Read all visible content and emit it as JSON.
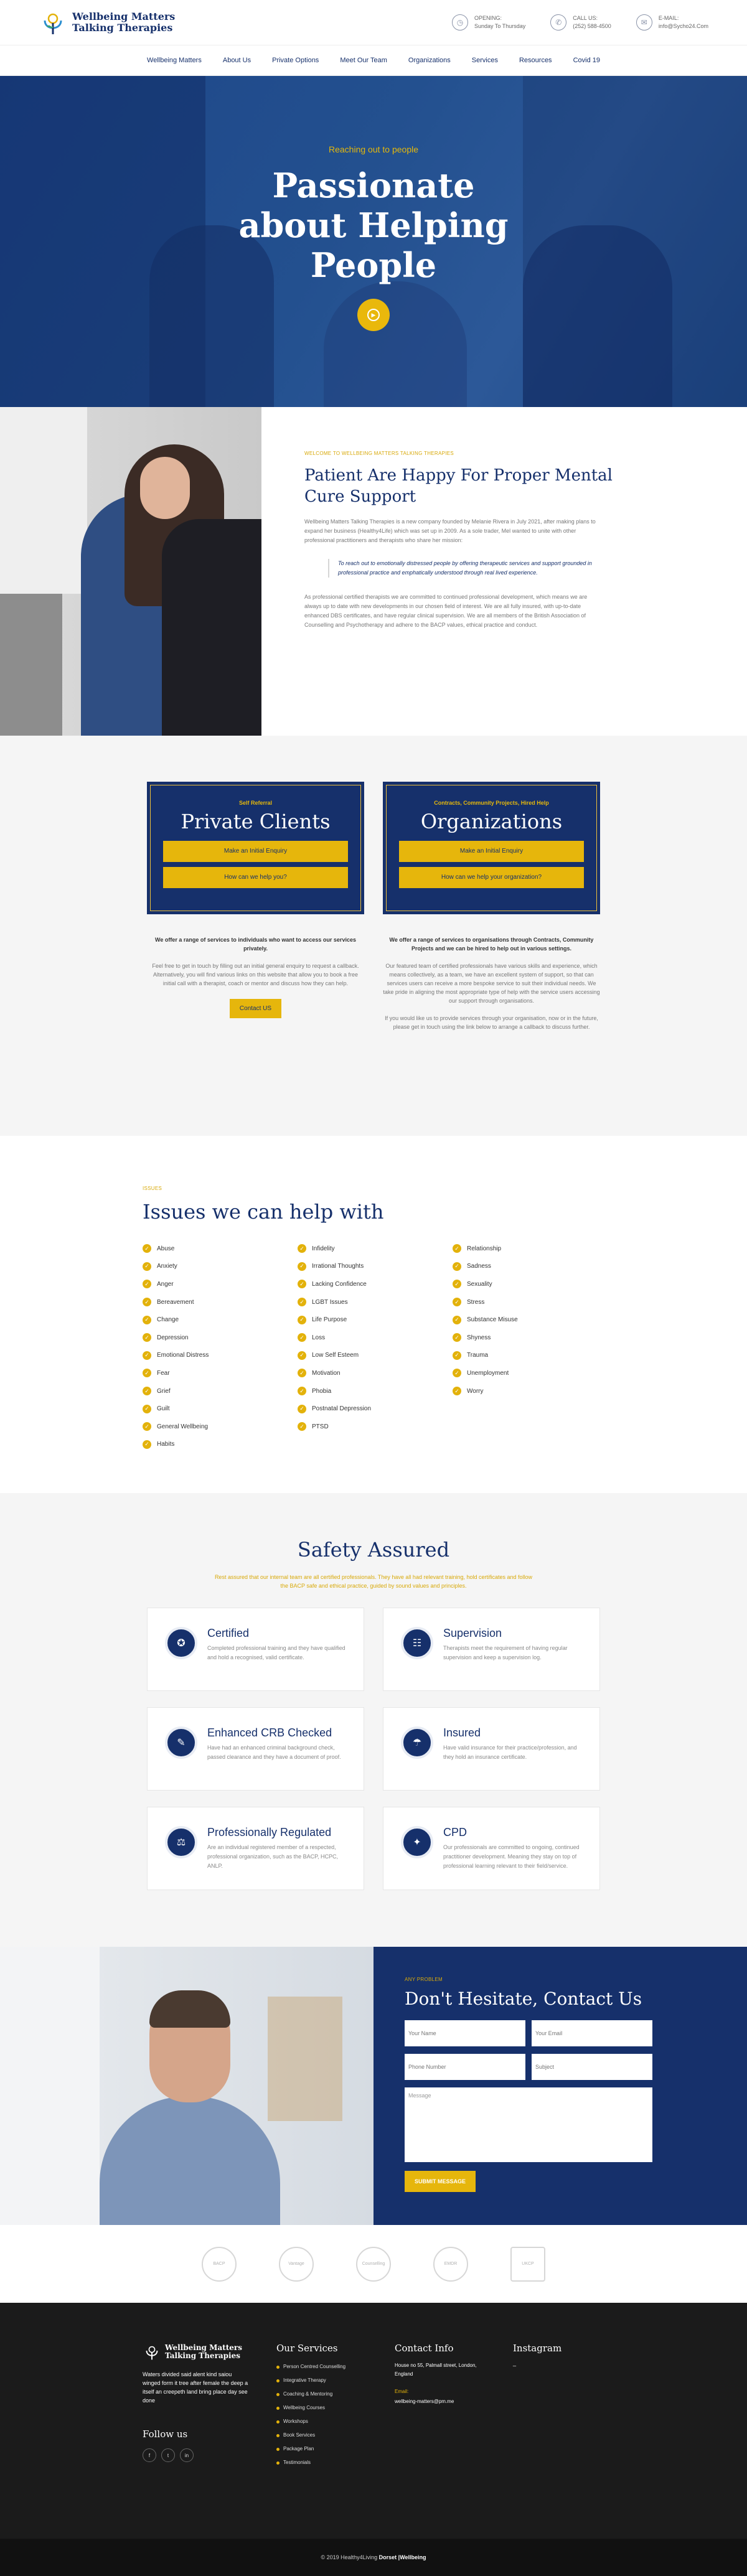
{
  "brand": {
    "line1": "Wellbeing Matters",
    "line2": "Talking Therapies"
  },
  "header": {
    "contacts": [
      {
        "icon": "clock-icon",
        "label": "OPENING:",
        "value": "Sunday To Thursday"
      },
      {
        "icon": "phone-icon",
        "label": "CALL US:",
        "value": "(252) 588-4500"
      },
      {
        "icon": "mail-icon",
        "label": "E-MAIL:",
        "value": "info@Sycho24.Com"
      }
    ]
  },
  "nav": [
    "Wellbeing Matters",
    "About Us",
    "Private Options",
    "Meet Our Team",
    "Organizations",
    "Services",
    "Resources",
    "Covid 19"
  ],
  "hero": {
    "kicker": "Reaching out to people",
    "title_l1": "Passionate",
    "title_l2": "about Helping",
    "title_l3": "People"
  },
  "about": {
    "kicker": "WELCOME TO WELLBEING MATTERS TALKING THERAPIES",
    "title": "Patient Are Happy For Proper Mental Cure Support",
    "p1": "Wellbeing Matters Talking Therapies is a new company founded by Melanie Rivera in July 2021, after making plans to expand her business (Healthy4Life) which was set up in 2009. As a sole trader, Mel wanted to unite with other professional practitioners and therapists who share her mission:",
    "quote": "To reach out to emotionally distressed people by offering therapeutic services and support grounded in professional practice and emphatically understood through real lived experience.",
    "p2": "As professional certified therapists we are committed to continued professional development, which means we are always up to date with new developments in our chosen field of interest. We are all fully insured, with up-to-date enhanced DBS certificates, and have regular clinical supervision. We are all members of the British Association of Counselling and Psychotherapy and adhere to the BACP values, ethical practice and conduct."
  },
  "cards": [
    {
      "kicker": "Self Referral",
      "title": "Private Clients",
      "btn1": "Make an Initial Enquiry",
      "btn2": "How can we help you?",
      "lead": "We offer a range of services to individuals who want to access our services privately.",
      "body": "Feel free to get in touch by filling out an initial general enquiry to request a callback. Alternatively, you will find various links on this website that allow you to book a free initial call with a therapist, coach or mentor and discuss how they can help.",
      "extra": "",
      "button": "Contact US"
    },
    {
      "kicker": "Contracts, Community Projects, Hired Help",
      "title": "Organizations",
      "btn1": "Make an Initial Enquiry",
      "btn2": "How can we help your organization?",
      "lead": "We offer a range of services to organisations through Contracts, Community Projects and we can be hired to help out in various settings.",
      "body": "Our featured team of certified professionals have various skills and experience, which means collectively, as a team, we have an excellent system of support, so that can services users can receive a more bespoke service to suit their individual needs. We take pride in aligning the most appropriate type of help with the service users accessing our support through organisations.",
      "extra": "If you would like us to provide services through your organisation, now or in the future, please get in touch using the link below to arrange a callback to discuss further.",
      "button": ""
    }
  ],
  "issues": {
    "kicker": "ISSUES",
    "title": "Issues we can help with",
    "col1": [
      "Abuse",
      "Anxiety",
      "Anger",
      "Bereavement",
      "Change",
      "Depression",
      "Emotional Distress",
      "Fear",
      "Grief",
      "Guilt",
      "General Wellbeing",
      "Habits"
    ],
    "col2": [
      "Infidelity",
      "Irrational Thoughts",
      "Lacking Confidence",
      "LGBT Issues",
      "Life Purpose",
      "Loss",
      "Low Self Esteem",
      "Motivation",
      "Phobia",
      "Postnatal Depression",
      "PTSD"
    ],
    "col3": [
      "Relationship",
      "Sadness",
      "Sexuality",
      "Stress",
      "Substance Misuse",
      "Shyness",
      "Trauma",
      "Unemployment",
      "Worry"
    ]
  },
  "safety": {
    "title": "Safety Assured",
    "sub": "Rest assured that our internal team are all certified professionals. They have all had relevant training, hold certificates and follow the BACP safe and ethical practice, guided by sound values and principles.",
    "items": [
      {
        "icon": "certificate-icon",
        "glyph": "✪",
        "title": "Certified",
        "text": "Completed professional training and they have qualified and hold a recognised, valid certificate."
      },
      {
        "icon": "supervision-icon",
        "glyph": "☷",
        "title": "Supervision",
        "text": "Therapists meet the requirement of having regular supervision and keep a supervision log."
      },
      {
        "icon": "crb-check-icon",
        "glyph": "✎",
        "title": "Enhanced CRB Checked",
        "text": "Have had an enhanced criminal background check, passed clearance and they have a document of proof."
      },
      {
        "icon": "insured-icon",
        "glyph": "☂",
        "title": "Insured",
        "text": "Have valid insurance for their practice/profession, and they hold an insurance certificate."
      },
      {
        "icon": "regulated-icon",
        "glyph": "⚖",
        "title": "Professionally Regulated",
        "text": "Are an individual registered member of a respected, professional organization, such as the BACP, HCPC, ANLP."
      },
      {
        "icon": "cpd-icon",
        "glyph": "✦",
        "title": "CPD",
        "text": "Our professionals are committed to ongoing, continued practitioner development. Meaning they stay on top of professional learning relevant to their field/service."
      }
    ]
  },
  "contact": {
    "kicker": "ANY PROBLEM",
    "title": "Don't Hesitate, Contact Us",
    "name_ph": "Your Name",
    "email_ph": "Your Email",
    "phone_ph": "Phone Number",
    "subject_ph": "Subject",
    "message_ph": "Message",
    "submit": "SUBMIT MESSAGE"
  },
  "partners": [
    "BACP",
    "Vantage",
    "Counselling",
    "EMDR",
    "UKCP"
  ],
  "footer": {
    "about": "Waters divided said alent kind saiou winged form it tree after female the deep a itself an creepeth land bring place day see done",
    "follow": "Follow us",
    "socials": [
      "f",
      "t",
      "in"
    ],
    "services_title": "Our Services",
    "services": [
      "Person Centred Counselling",
      "Integrative Therapy",
      "Coaching & Mentoring",
      "Wellbeing Courses",
      "Workshops",
      "Book Services",
      "Package Plan",
      "Testimonials"
    ],
    "contact_title": "Contact Info",
    "address": "House no 55, Palmall street, London, England",
    "email_label": "Email:",
    "email": "wellbeing-matters@pm.me",
    "instagram_title": "Instagram",
    "instagram_dash": "_",
    "copyright": "© 2019 Healthy4Living",
    "copyright_strong": "Dorset |Wellbeing"
  },
  "colors": {
    "navy": "#16306b",
    "gold": "#e6b60c",
    "footer": "#1b1b1b"
  }
}
